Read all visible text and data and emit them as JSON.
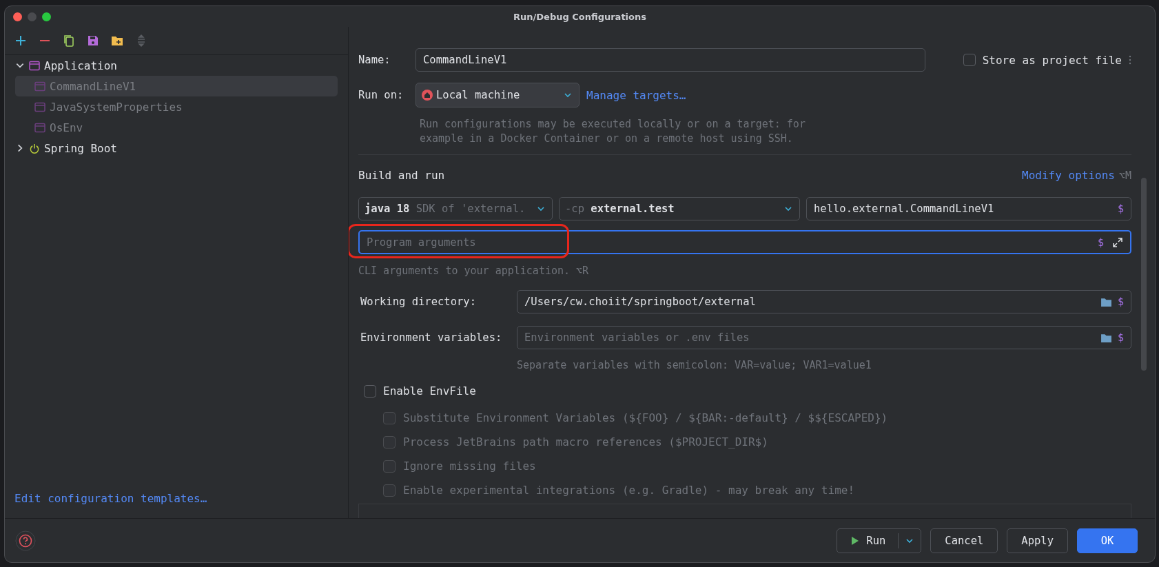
{
  "window": {
    "title": "Run/Debug Configurations"
  },
  "sidebar": {
    "tree": [
      {
        "label": "Application",
        "kind": "application",
        "expanded": true,
        "children": [
          {
            "label": "CommandLineV1",
            "selected": true
          },
          {
            "label": "JavaSystemProperties",
            "selected": false
          },
          {
            "label": "OsEnv",
            "selected": false
          }
        ]
      },
      {
        "label": "Spring Boot",
        "kind": "spring",
        "expanded": false
      }
    ],
    "link": "Edit configuration templates…"
  },
  "form": {
    "name": {
      "label": "Name:",
      "value": "CommandLineV1"
    },
    "store_as_project_file": {
      "label": "Store as project file",
      "checked": false
    },
    "run_on": {
      "label": "Run on:",
      "value": "Local machine",
      "link": "Manage targets…",
      "hint": "Run configurations may be executed locally or on a target: for\nexample in a Docker Container or on a remote host using SSH."
    },
    "build_and_run": {
      "title": "Build and run",
      "modify_options": "Modify options",
      "shortcut": "⌥M",
      "jre": {
        "value": "java 18",
        "hint": "SDK of 'external."
      },
      "classpath": {
        "prefix": "-cp",
        "value": "external.test"
      },
      "main_class": {
        "value": "hello.external.CommandLineV1",
        "macro": "$"
      },
      "program_arguments": {
        "placeholder": "Program arguments",
        "macro": "$",
        "focused": true,
        "annotated": true
      },
      "hint": "CLI arguments to your application. ⌥R"
    },
    "working_directory": {
      "label": "Working directory:",
      "value": "/Users/cw.choiit/springboot/external",
      "macro": "$"
    },
    "environment_variables": {
      "label": "Environment variables:",
      "placeholder": "Environment variables or .env files",
      "macro": "$",
      "hint": "Separate variables with semicolon: VAR=value; VAR1=value1"
    },
    "enable_envfile": {
      "label": "Enable EnvFile",
      "checked": false
    },
    "envfile_options": [
      {
        "label": "Substitute Environment Variables (${FOO} / ${BAR:-default} / $${ESCAPED})",
        "checked": false,
        "disabled": true
      },
      {
        "label": "Process JetBrains path macro references ($PROJECT_DIR$)",
        "checked": false,
        "disabled": true
      },
      {
        "label": "Ignore missing files",
        "checked": false,
        "disabled": true
      },
      {
        "label": "Enable experimental integrations (e.g. Gradle) - may break any time!",
        "checked": false,
        "disabled": true
      }
    ]
  },
  "buttons": [
    {
      "label": "Run",
      "kind": "split"
    },
    {
      "label": "Cancel",
      "kind": "normal"
    },
    {
      "label": "Apply",
      "kind": "normal"
    },
    {
      "label": "OK",
      "kind": "default"
    }
  ]
}
